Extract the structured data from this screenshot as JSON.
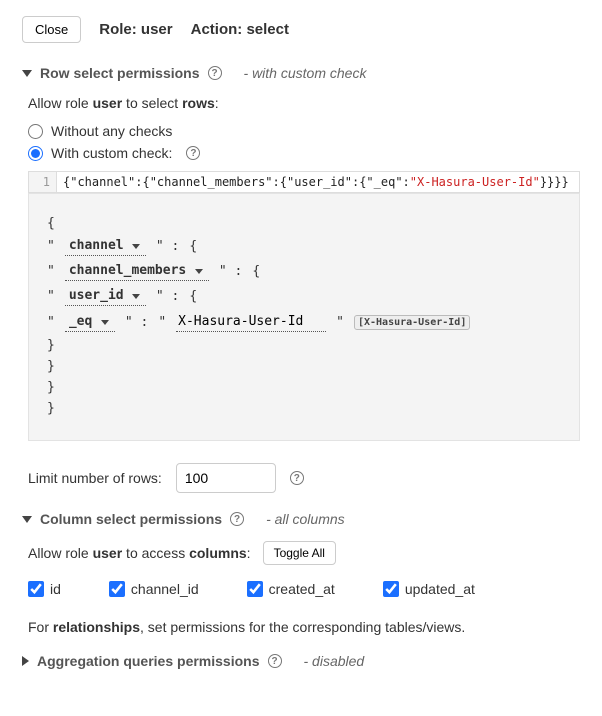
{
  "close_label": "Close",
  "header": {
    "role_label": "Role:",
    "role_value": "user",
    "action_label": "Action:",
    "action_value": "select"
  },
  "row_section": {
    "title": "Row select permissions",
    "status": "- with custom check",
    "allow_prefix": "Allow role ",
    "allow_role": "user",
    "allow_mid": " to select ",
    "allow_target": "rows",
    "allow_suffix": ":",
    "radio_no_checks": "Without any checks",
    "radio_custom": "With custom check:",
    "code_json": "{\"channel\":{\"channel_members\":{\"user_id\":{\"_eq\":\"X-Hasura-User-Id\"}}}}",
    "builder": {
      "field1": "channel",
      "field2": "channel_members",
      "field3": "user_id",
      "op": "_eq",
      "value": "X-Hasura-User-Id",
      "chip": "[X-Hasura-User-Id]"
    },
    "limit_label": "Limit number of rows:",
    "limit_value": "100"
  },
  "col_section": {
    "title": "Column select permissions",
    "status": "- all columns",
    "allow_prefix": "Allow role ",
    "allow_role": "user",
    "allow_mid": " to access ",
    "allow_target": "columns",
    "allow_suffix": ":",
    "toggle_label": "Toggle All",
    "columns": [
      "id",
      "channel_id",
      "created_at",
      "updated_at"
    ],
    "rel_prefix": "For ",
    "rel_bold": "relationships",
    "rel_suffix": ", set permissions for the corresponding tables/views."
  },
  "agg_section": {
    "title": "Aggregation queries permissions",
    "status": "- disabled"
  }
}
